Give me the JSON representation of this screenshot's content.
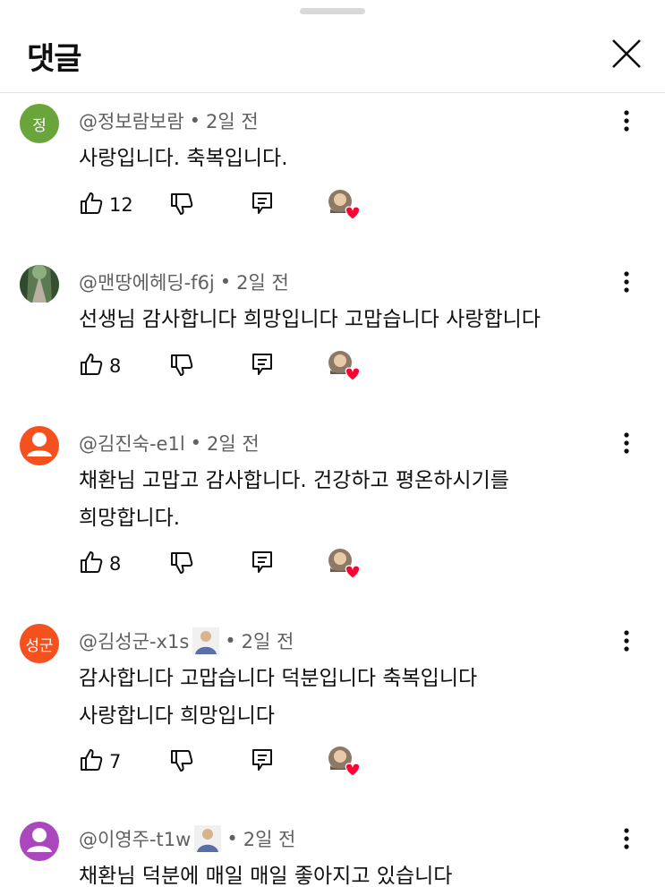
{
  "header": {
    "title": "댓글"
  },
  "comments": [
    {
      "avatar_type": "letter",
      "avatar_text": "정",
      "avatar_color": "#6aa53b",
      "author": "@정보람보람",
      "time": "2일 전",
      "lines": [
        "사랑입니다. 축복입니다."
      ],
      "likes": "12",
      "creator_heart": true
    },
    {
      "avatar_type": "photo",
      "avatar_icon": "forest-path-photo",
      "author": "@맨땅에헤딩-f6j",
      "time": "2일 전",
      "lines": [
        "선생님 감사합니다 희망입니다 고맙습니다 사랑합니다"
      ],
      "likes": "8",
      "creator_heart": true
    },
    {
      "avatar_type": "person",
      "avatar_color": "#f4511e",
      "author": "@김진숙-e1l",
      "time": "2일 전",
      "lines": [
        "채환님 고맙고 감사합니다. 건강하고 평온하시기를",
        "희망합니다."
      ],
      "likes": "8",
      "creator_heart": true
    },
    {
      "avatar_type": "letter",
      "avatar_text": "성군",
      "avatar_color": "#f4511e",
      "author": "@김성군-x1s",
      "badge_icon": "member-badge-icon",
      "time": "2일 전",
      "lines": [
        "감사합니다  고맙습니다 덕분입니다 축복입니다",
        "사랑합니다 희망입니다"
      ],
      "likes": "7",
      "creator_heart": true
    },
    {
      "avatar_type": "person",
      "avatar_color": "#ab47bc",
      "author": "@이영주-t1w",
      "badge_icon": "member-badge-icon",
      "time": "2일 전",
      "lines": [
        "채환님  덕분에  매일 매일  좋아지고 있습니다"
      ]
    }
  ],
  "icons": {
    "like": "thumbs-up-icon",
    "dislike": "thumbs-down-icon",
    "reply": "reply-icon",
    "more": "more-vert-icon",
    "close": "close-icon",
    "heart": "creator-heart-icon"
  },
  "colors": {
    "text_primary": "#0f0f0f",
    "text_secondary": "#606060",
    "heart": "#ff0033",
    "divider": "#e5e5e5"
  }
}
